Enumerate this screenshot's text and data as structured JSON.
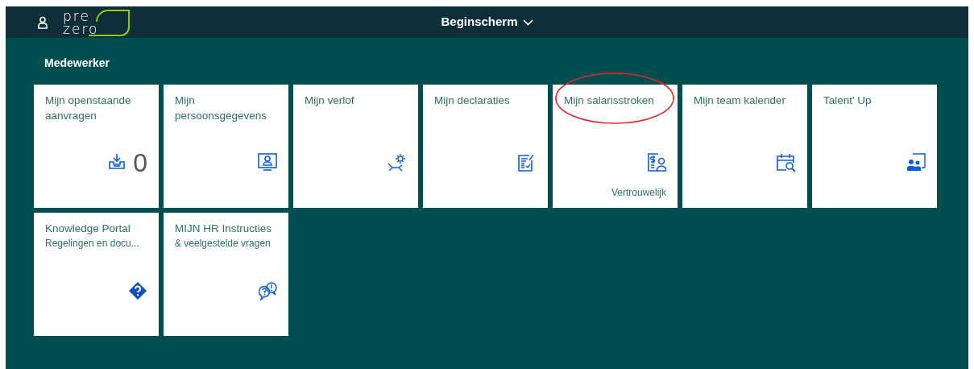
{
  "header": {
    "logo": [
      "pre",
      "zero"
    ],
    "title": "Beginscherm"
  },
  "section": {
    "title": "Medewerker"
  },
  "tiles": [
    {
      "title": "Mijn openstaande aanvragen",
      "count": "0",
      "highlighted": false
    },
    {
      "title": "Mijn persoonsgegevens",
      "highlighted": false
    },
    {
      "title": "Mijn verlof",
      "highlighted": false
    },
    {
      "title": "Mijn declaraties",
      "highlighted": false
    },
    {
      "title": "Mijn salarisstroken",
      "footer": "Vertrouwelijk",
      "highlighted": true
    },
    {
      "title": "Mijn team kalender",
      "highlighted": false
    },
    {
      "title": "Talent' Up",
      "highlighted": false
    },
    {
      "title": "Knowledge Portal",
      "subtitle": "Regelingen en docu...",
      "highlighted": false
    },
    {
      "title": "MIJN HR Instructies",
      "subtitle": "& veelgestelde vragen",
      "highlighted": false
    }
  ]
}
